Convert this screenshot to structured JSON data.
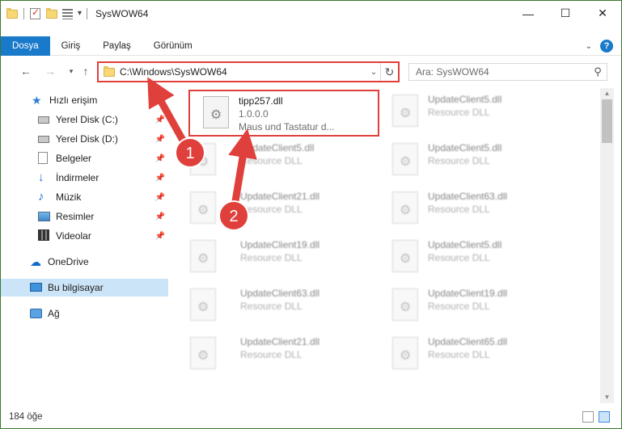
{
  "window": {
    "title": "SysWOW64"
  },
  "ribbon": {
    "tabs": [
      "Dosya",
      "Giriş",
      "Paylaş",
      "Görünüm"
    ],
    "help": "?"
  },
  "address": {
    "path": "C:\\Windows\\SysWOW64"
  },
  "search": {
    "placeholder": "Ara: SysWOW64"
  },
  "sidebar": {
    "items": [
      {
        "label": "Hızlı erişim"
      },
      {
        "label": "Yerel Disk (C:)"
      },
      {
        "label": "Yerel Disk (D:)"
      },
      {
        "label": "Belgeler"
      },
      {
        "label": "İndirmeler"
      },
      {
        "label": "Müzik"
      },
      {
        "label": "Resimler"
      },
      {
        "label": "Videolar"
      },
      {
        "label": "OneDrive"
      },
      {
        "label": "Bu bilgisayar"
      },
      {
        "label": "Ağ"
      }
    ]
  },
  "files": [
    {
      "name": "tipp257.dll",
      "line2": "1.0.0.0",
      "line3": "Maus und Tastatur d..."
    },
    {
      "name": "UpdateClient5.dll",
      "line2": "Resource DLL"
    },
    {
      "name": "UpdateClient5.dll",
      "line2": "Resource DLL"
    },
    {
      "name": "UpdateClient5.dll",
      "line2": "Resource DLL"
    },
    {
      "name": "UpdateClient21.dll",
      "line2": "Resource DLL"
    },
    {
      "name": "UpdateClient63.dll",
      "line2": "Resource DLL"
    },
    {
      "name": "UpdateClient19.dll",
      "line2": "Resource DLL"
    },
    {
      "name": "UpdateClient5.dll",
      "line2": "Resource DLL"
    },
    {
      "name": "UpdateClient63.dll",
      "line2": "Resource DLL"
    },
    {
      "name": "UpdateClient19.dll",
      "line2": "Resource DLL"
    },
    {
      "name": "UpdateClient21.dll",
      "line2": "Resource DLL"
    },
    {
      "name": "UpdateClient65.dll",
      "line2": "Resource DLL"
    }
  ],
  "status": {
    "count": "184 öğe"
  },
  "annotations": {
    "badge1": "1",
    "badge2": "2"
  },
  "colors": {
    "accent": "#1979ca",
    "highlight": "#e0403b",
    "selection": "#cce4f7"
  }
}
